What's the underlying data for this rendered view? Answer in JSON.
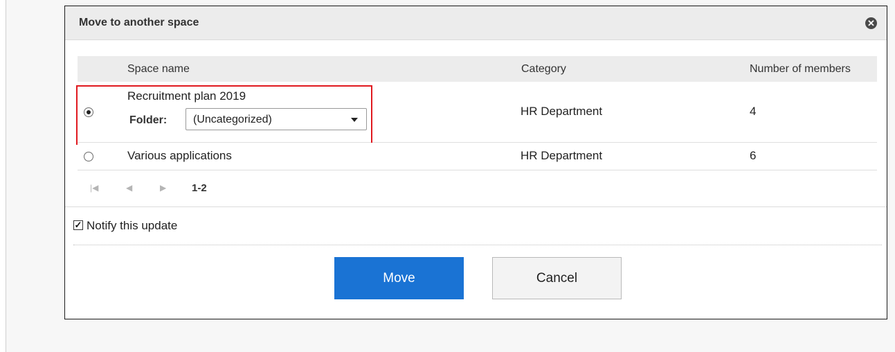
{
  "dialog": {
    "title": "Move to another space",
    "close_glyph": "✕"
  },
  "table": {
    "headers": {
      "space_name": "Space name",
      "category": "Category",
      "members": "Number of members"
    },
    "rows": [
      {
        "selected": true,
        "name": "Recruitment plan 2019",
        "category": "HR Department",
        "members": "4",
        "folder": {
          "label": "Folder:",
          "value": "(Uncategorized)"
        }
      },
      {
        "selected": false,
        "name": "Various applications",
        "category": "HR Department",
        "members": "6"
      }
    ]
  },
  "pager": {
    "first_icon": "first-page-icon",
    "prev_icon": "prev-page-icon",
    "next_icon": "next-page-icon",
    "range": "1-2"
  },
  "notify": {
    "checked": true,
    "label": "Notify this update"
  },
  "buttons": {
    "move": "Move",
    "cancel": "Cancel"
  },
  "colors": {
    "primary": "#1a73d4",
    "highlight": "#e0191f",
    "header_bg": "#ececec"
  }
}
